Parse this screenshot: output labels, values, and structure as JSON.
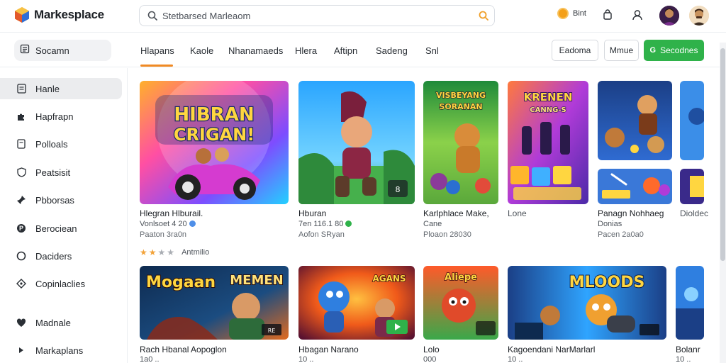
{
  "header": {
    "app_name": "Markesplace",
    "search_value": "Stetbarsed Marleaom",
    "coin_label": "Bint"
  },
  "toolbar": {
    "side_search_label": "Socamn",
    "tabs": [
      "Hlapans",
      "Kaole",
      "Nhanamaeds",
      "Hlera",
      "Aftipn",
      "Sadeng",
      "Snl"
    ],
    "buttons": {
      "first": "Eadoma",
      "second": "Mmue",
      "primary": "Secodnes"
    }
  },
  "sidebar": {
    "items": [
      {
        "label": "Hanle",
        "icon": "doc-icon"
      },
      {
        "label": "Hapfrapn",
        "icon": "puzzle-icon"
      },
      {
        "label": "Polloals",
        "icon": "page-icon"
      },
      {
        "label": "Peatsisit",
        "icon": "shield-icon"
      },
      {
        "label": "Pbborsas",
        "icon": "pin-icon"
      },
      {
        "label": "Berociean",
        "icon": "circle-p-icon"
      },
      {
        "label": "Daciders",
        "icon": "ring-icon"
      },
      {
        "label": "Copinlaclies",
        "icon": "diamond-icon"
      },
      {
        "label": "Madnale",
        "icon": "heart-icon"
      },
      {
        "label": "Markaplans",
        "icon": "chevron-right-icon"
      }
    ]
  },
  "row1": [
    {
      "title": "Hlegran Hlburail.",
      "sub": "Vonlsoet 4 20",
      "sub2": "Paaton 3ra0n",
      "thumb_text": "HIBRAN CRIGAN!"
    },
    {
      "title": "Hburan",
      "sub": "7en 116.1 80",
      "sub2": "Aofon SRyan"
    },
    {
      "title": "Karlphlace Make,",
      "sub": "Cane",
      "sub2": "Ploaon 28030",
      "thumb_text": "VISBEYANG SORANAN"
    },
    {
      "title": "Lone",
      "sub": "",
      "sub2": "",
      "thumb_text": "KRENEN CANNG-S"
    },
    {
      "title": "Panagn Nohhaeg",
      "sub": "Donias",
      "sub2": "Pacen 2a0a0"
    },
    {
      "title": "Dioldec",
      "sub": "",
      "sub2": ""
    }
  ],
  "rating": {
    "filled": 3,
    "total": 4,
    "label": "Antmilio"
  },
  "row2": [
    {
      "title": "Rach Hbanal Aopoglon",
      "sub": "1a0 ..",
      "thumb_text": "Mogaan MEMEN"
    },
    {
      "title": "Hbagan Narano",
      "sub": "10 .."
    },
    {
      "title": "Lolo",
      "sub": "000",
      "thumb_text": "Aliepe"
    },
    {
      "title": "Kagoendani NarMarlarl",
      "sub": "10 ..",
      "thumb_text": "MLOODS"
    },
    {
      "title": "Bolanr",
      "sub": "10 .."
    }
  ]
}
